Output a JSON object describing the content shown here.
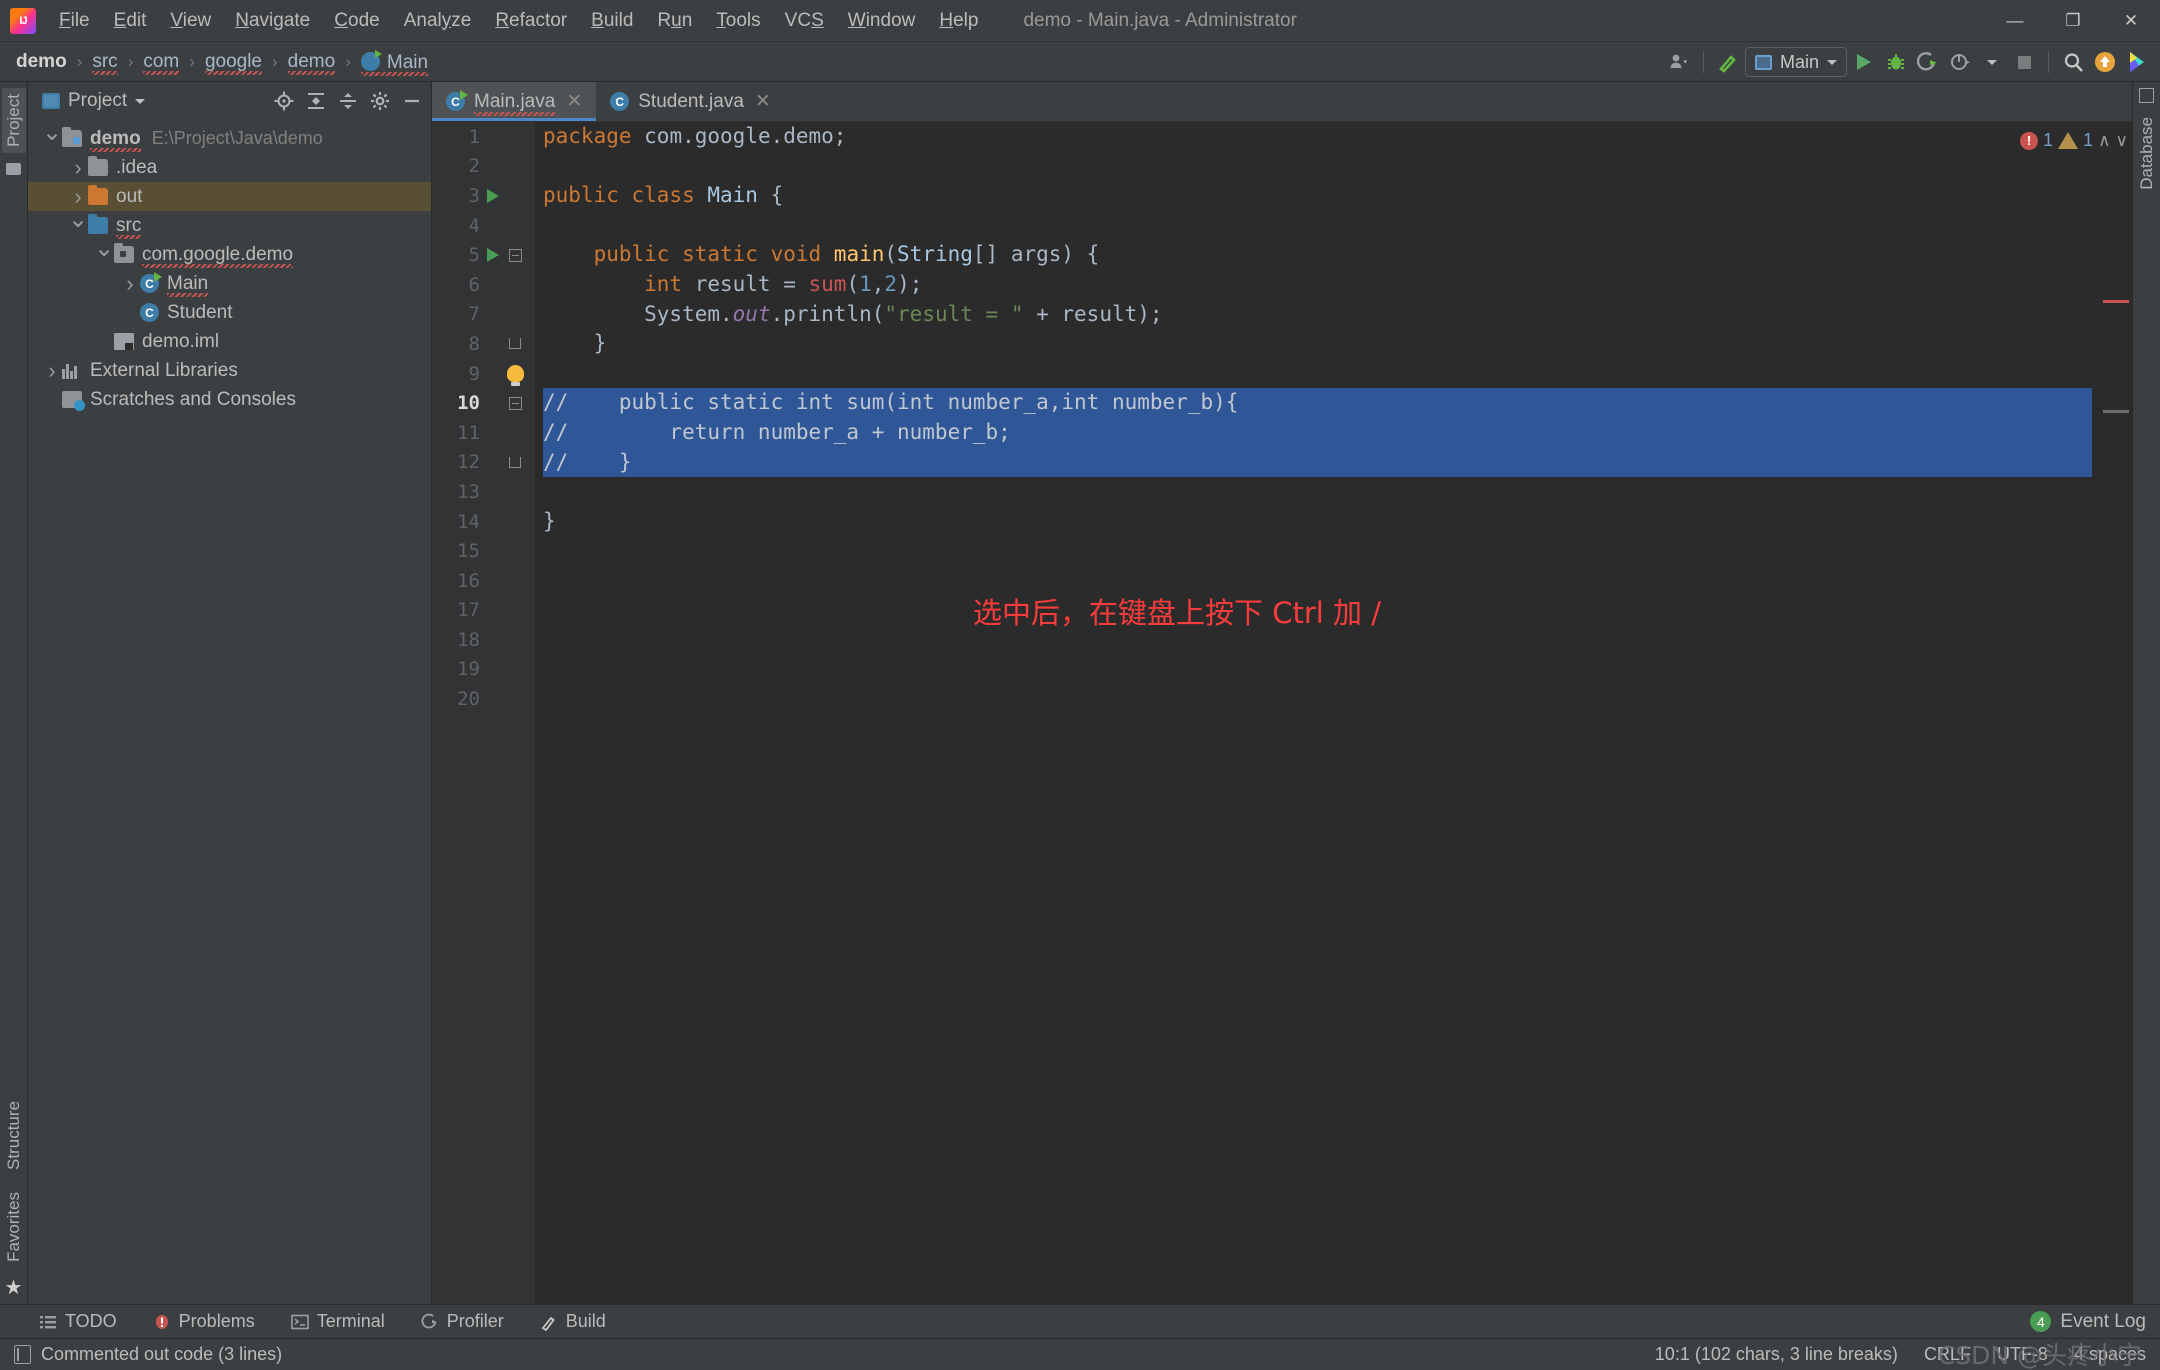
{
  "window": {
    "title": "demo - Main.java - Administrator",
    "minimize": "—",
    "maximize": "❐",
    "close": "✕"
  },
  "menubar": [
    {
      "label": "File",
      "mnemonic": "F"
    },
    {
      "label": "Edit",
      "mnemonic": "E"
    },
    {
      "label": "View",
      "mnemonic": "V"
    },
    {
      "label": "Navigate",
      "mnemonic": "N"
    },
    {
      "label": "Code",
      "mnemonic": "C"
    },
    {
      "label": "Analyze",
      "mnemonic": "y"
    },
    {
      "label": "Refactor",
      "mnemonic": "R"
    },
    {
      "label": "Build",
      "mnemonic": "B"
    },
    {
      "label": "Run",
      "mnemonic": "u"
    },
    {
      "label": "Tools",
      "mnemonic": "T"
    },
    {
      "label": "VCS",
      "mnemonic": "S"
    },
    {
      "label": "Window",
      "mnemonic": "W"
    },
    {
      "label": "Help",
      "mnemonic": "H"
    }
  ],
  "breadcrumb": [
    {
      "label": "demo",
      "squiggle": false,
      "bold": true
    },
    {
      "label": "src",
      "squiggle": true,
      "bold": false
    },
    {
      "label": "com",
      "squiggle": true,
      "bold": false
    },
    {
      "label": "google",
      "squiggle": true,
      "bold": false
    },
    {
      "label": "demo",
      "squiggle": true,
      "bold": false
    },
    {
      "label": "Main",
      "squiggle": true,
      "bold": false
    }
  ],
  "toolbar": {
    "run_config": "Main",
    "icons": [
      "user-settings-icon",
      "build-hammer-icon",
      "run-icon",
      "debug-icon",
      "run-coverage-icon",
      "profiler-icon",
      "stop-icon",
      "search-everywhere-icon",
      "update-project-icon",
      "idea-assistant-icon"
    ]
  },
  "sidebars": {
    "left_top": "Project",
    "left_bottom": [
      "Structure",
      "Favorites"
    ],
    "right": "Database"
  },
  "project_panel": {
    "title": "Project",
    "tools": [
      "locate-icon",
      "expand-all-icon",
      "collapse-all-icon",
      "settings-icon",
      "hide-icon"
    ],
    "tree": [
      {
        "label": "demo",
        "path": "E:\\Project\\Java\\demo",
        "indent": 0,
        "icon": "module",
        "twisty": "down",
        "bold": true,
        "squiggle": true,
        "selected": false
      },
      {
        "label": ".idea",
        "path": "",
        "indent": 1,
        "icon": "folder",
        "twisty": "right",
        "bold": false,
        "squiggle": false,
        "selected": false
      },
      {
        "label": "out",
        "path": "",
        "indent": 1,
        "icon": "folder-orange",
        "twisty": "right",
        "bold": false,
        "squiggle": false,
        "selected": true
      },
      {
        "label": "src",
        "path": "",
        "indent": 1,
        "icon": "folder-blue",
        "twisty": "down",
        "bold": false,
        "squiggle": true,
        "selected": false
      },
      {
        "label": "com.google.demo",
        "path": "",
        "indent": 2,
        "icon": "package",
        "twisty": "down",
        "bold": false,
        "squiggle": true,
        "selected": false
      },
      {
        "label": "Main",
        "path": "",
        "indent": 3,
        "icon": "class-runnable",
        "twisty": "right",
        "bold": false,
        "squiggle": true,
        "selected": false
      },
      {
        "label": "Student",
        "path": "",
        "indent": 3,
        "icon": "class",
        "twisty": "none",
        "bold": false,
        "squiggle": false,
        "selected": false
      },
      {
        "label": "demo.iml",
        "path": "",
        "indent": 2,
        "icon": "file",
        "twisty": "none",
        "bold": false,
        "squiggle": false,
        "selected": false
      },
      {
        "label": "External Libraries",
        "path": "",
        "indent": 0,
        "icon": "library",
        "twisty": "right",
        "bold": false,
        "squiggle": false,
        "selected": false
      },
      {
        "label": "Scratches and Consoles",
        "path": "",
        "indent": 0,
        "icon": "scratch",
        "twisty": "none",
        "bold": false,
        "squiggle": false,
        "selected": false
      }
    ]
  },
  "editor": {
    "tabs": [
      {
        "label": "Main.java",
        "active": true,
        "squiggle": true,
        "runnable": true
      },
      {
        "label": "Student.java",
        "active": false,
        "squiggle": false,
        "runnable": false
      }
    ],
    "close_glyph": "✕",
    "line_numbers": [
      "1",
      "2",
      "3",
      "4",
      "5",
      "6",
      "7",
      "8",
      "9",
      "10",
      "11",
      "12",
      "13",
      "14",
      "15",
      "16",
      "17",
      "18",
      "19",
      "20"
    ],
    "current_line": 10,
    "inspection": {
      "error_count": "1",
      "warning_count": "1",
      "up_glyph": "∧",
      "down_glyph": "∨"
    },
    "annotation": "选中后，在键盘上按下 Ctrl 加 /",
    "code": [
      {
        "n": 1,
        "selected": false,
        "tokens": [
          {
            "t": "package ",
            "c": "kw"
          },
          {
            "t": "com.google.demo;",
            "c": "ident"
          }
        ]
      },
      {
        "n": 2,
        "selected": false,
        "tokens": []
      },
      {
        "n": 3,
        "selected": false,
        "gutter_run": true,
        "tokens": [
          {
            "t": "public class ",
            "c": "kw"
          },
          {
            "t": "Main ",
            "c": "clsname"
          },
          {
            "t": "{",
            "c": "ident"
          }
        ]
      },
      {
        "n": 4,
        "selected": false,
        "tokens": []
      },
      {
        "n": 5,
        "selected": false,
        "gutter_run": true,
        "tokens": [
          {
            "t": "    public static void ",
            "c": "kw"
          },
          {
            "t": "main",
            "c": "mth"
          },
          {
            "t": "(",
            "c": "ident"
          },
          {
            "t": "String",
            "c": "clsname"
          },
          {
            "t": "[] args) {",
            "c": "ident"
          }
        ]
      },
      {
        "n": 6,
        "selected": false,
        "tokens": [
          {
            "t": "        int ",
            "c": "kw"
          },
          {
            "t": "result = ",
            "c": "ident"
          },
          {
            "t": "sum",
            "c": "err"
          },
          {
            "t": "(",
            "c": "ident"
          },
          {
            "t": "1",
            "c": "num"
          },
          {
            "t": ",",
            "c": "ident"
          },
          {
            "t": "2",
            "c": "num"
          },
          {
            "t": ");",
            "c": "ident"
          }
        ]
      },
      {
        "n": 7,
        "selected": false,
        "tokens": [
          {
            "t": "        System.",
            "c": "ident"
          },
          {
            "t": "out",
            "c": "stat"
          },
          {
            "t": ".println(",
            "c": "ident"
          },
          {
            "t": "\"result = \"",
            "c": "str"
          },
          {
            "t": " + result);",
            "c": "ident"
          }
        ]
      },
      {
        "n": 8,
        "selected": false,
        "tokens": [
          {
            "t": "    }",
            "c": "ident"
          }
        ]
      },
      {
        "n": 9,
        "selected": false,
        "tokens": []
      },
      {
        "n": 10,
        "selected": true,
        "tokens": [
          {
            "t": "//    public static int sum(int number_a,int number_b){",
            "c": "sel-text"
          }
        ]
      },
      {
        "n": 11,
        "selected": true,
        "tokens": [
          {
            "t": "//        return number_a + number_b;",
            "c": "sel-text"
          }
        ]
      },
      {
        "n": 12,
        "selected": true,
        "tokens": [
          {
            "t": "//    }",
            "c": "sel-text"
          }
        ]
      },
      {
        "n": 13,
        "selected": false,
        "tokens": []
      },
      {
        "n": 14,
        "selected": false,
        "tokens": [
          {
            "t": "}",
            "c": "ident"
          }
        ]
      },
      {
        "n": 15,
        "selected": false,
        "tokens": []
      },
      {
        "n": 16,
        "selected": false,
        "tokens": []
      },
      {
        "n": 17,
        "selected": false,
        "tokens": []
      },
      {
        "n": 18,
        "selected": false,
        "tokens": []
      },
      {
        "n": 19,
        "selected": false,
        "tokens": []
      },
      {
        "n": 20,
        "selected": false,
        "tokens": []
      }
    ]
  },
  "bottom_bar": {
    "items": [
      {
        "label": "TODO",
        "icon": "todo-icon"
      },
      {
        "label": "Problems",
        "icon": "problems-icon"
      },
      {
        "label": "Terminal",
        "icon": "terminal-icon"
      },
      {
        "label": "Profiler",
        "icon": "profiler-icon"
      },
      {
        "label": "Build",
        "icon": "build-icon"
      }
    ],
    "event_log": {
      "label": "Event Log",
      "badge": "4"
    }
  },
  "status_bar": {
    "message": "Commented out code (3 lines)",
    "caret": "10:1 (102 chars, 3 line breaks)",
    "line_separator": "CRLF",
    "encoding": "UTF-8",
    "indent": "4 spaces",
    "watermark": "CSDN @头疼小宁"
  },
  "colors": {
    "accent": "#4a88c7",
    "selection": "#2f5797",
    "tree_selection": "#594f35",
    "annotation": "#fa3c3c",
    "error": "#c75450",
    "keyword": "#cc7832",
    "string": "#6a8759",
    "number": "#6897bb",
    "method": "#ffc66d"
  }
}
